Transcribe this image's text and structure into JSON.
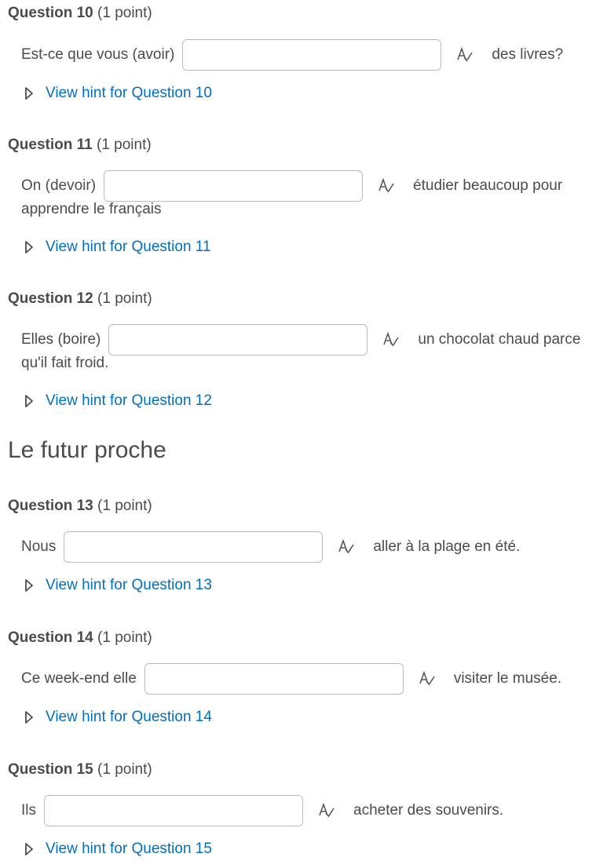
{
  "questions": [
    {
      "number": "Question 10",
      "points": "(1 point)",
      "before": "Est-ce que vous (avoir)",
      "after": "des livres?",
      "after2": "",
      "input_value": "",
      "hint": "View hint for Question 10"
    },
    {
      "number": "Question 11",
      "points": "(1 point)",
      "before": "On (devoir)",
      "after": "étudier beaucoup pour",
      "after2": "apprendre le français",
      "input_value": "",
      "hint": "View hint for Question 11"
    },
    {
      "number": "Question 12",
      "points": "(1 point)",
      "before": "Elles (boire)",
      "after": "un chocolat chaud parce",
      "after2": "qu'il fait froid.",
      "input_value": "",
      "hint": "View hint for Question 12"
    },
    {
      "number": "Question 13",
      "points": "(1 point)",
      "before": "Nous",
      "after": "aller à la plage en été.",
      "after2": "",
      "input_value": "",
      "hint": "View hint for Question 13"
    },
    {
      "number": "Question 14",
      "points": "(1 point)",
      "before": "Ce week-end elle",
      "after": "visiter le musée.",
      "after2": "",
      "input_value": "",
      "hint": "View hint for Question 14"
    },
    {
      "number": "Question 15",
      "points": "(1 point)",
      "before": "Ils",
      "after": "acheter des souvenirs.",
      "after2": "",
      "input_value": "",
      "hint": "View hint for Question 15"
    }
  ],
  "section": {
    "heading": "Le futur proche"
  },
  "colors": {
    "text": "#494c4e",
    "link": "#006fbf",
    "input_border": "#b8bcc0"
  },
  "icons": {
    "spellcheck": "spellcheck-icon",
    "hint_toggle": "play-triangle-icon"
  }
}
